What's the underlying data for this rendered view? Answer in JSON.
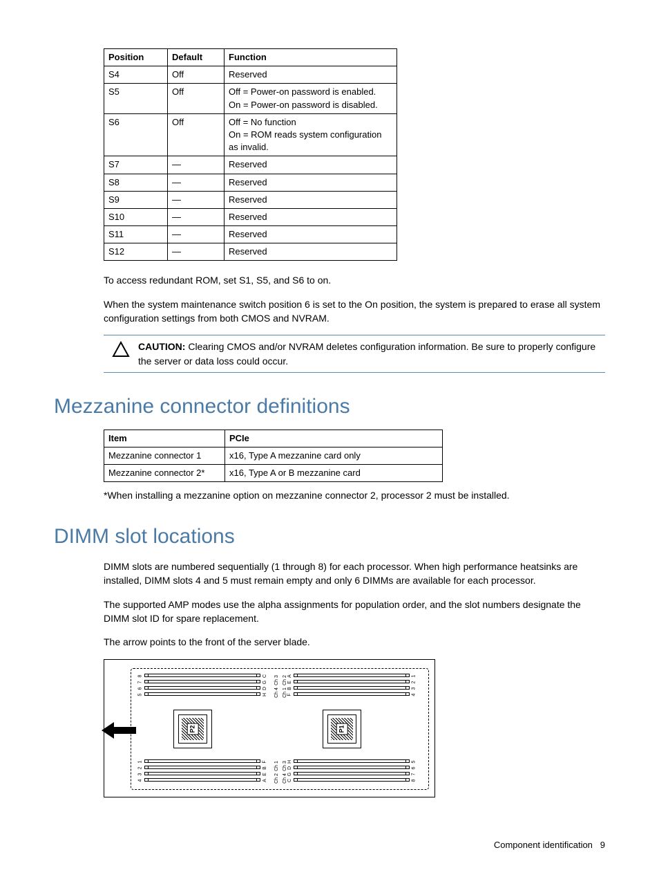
{
  "table1": {
    "headers": [
      "Position",
      "Default",
      "Function"
    ],
    "rows": [
      {
        "pos": "S4",
        "def": "Off",
        "fun": "Reserved"
      },
      {
        "pos": "S5",
        "def": "Off",
        "fun": "Off = Power-on password is enabled.\nOn = Power-on password is disabled."
      },
      {
        "pos": "S6",
        "def": "Off",
        "fun": "Off = No function\nOn = ROM reads system configuration as invalid."
      },
      {
        "pos": "S7",
        "def": "—",
        "fun": "Reserved"
      },
      {
        "pos": "S8",
        "def": "—",
        "fun": "Reserved"
      },
      {
        "pos": "S9",
        "def": "—",
        "fun": "Reserved"
      },
      {
        "pos": "S10",
        "def": "—",
        "fun": "Reserved"
      },
      {
        "pos": "S11",
        "def": "—",
        "fun": "Reserved"
      },
      {
        "pos": "S12",
        "def": "—",
        "fun": "Reserved"
      }
    ]
  },
  "para1": "To access redundant ROM, set S1, S5, and S6 to on.",
  "para2": "When the system maintenance switch position 6 is set to the On position, the system is prepared to erase all system configuration settings from both CMOS and NVRAM.",
  "caution_label": "CAUTION:",
  "caution_text": "  Clearing CMOS and/or NVRAM deletes configuration information. Be sure to properly configure the server or data loss could occur.",
  "heading1": "Mezzanine connector definitions",
  "table2": {
    "headers": [
      "Item",
      "PCIe"
    ],
    "rows": [
      {
        "item": "Mezzanine connector 1",
        "pcie": "x16, Type A mezzanine card only"
      },
      {
        "item": "Mezzanine connector 2*",
        "pcie": "x16, Type A or B mezzanine card"
      }
    ]
  },
  "footnote1": "*When installing a mezzanine option on mezzanine connector 2, processor 2 must be installed.",
  "heading2": "DIMM slot locations",
  "para3": "DIMM slots are numbered sequentially (1 through 8) for each processor. When high performance heatsinks are installed, DIMM slots 4 and 5 must remain empty and only 6 DIMMs are available for each processor.",
  "para4": "The supported AMP modes use the alpha assignments for population order, and the slot numbers designate the DIMM slot ID for spare replacement.",
  "para5": "The arrow points to the front of the server blade.",
  "diagram": {
    "p1": "P1",
    "p2": "P2",
    "ch1": "Ch 1",
    "ch2": "Ch 2",
    "ch3": "Ch 3",
    "ch4": "Ch 4",
    "nums_top_left": [
      "8",
      "7",
      "6",
      "5"
    ],
    "nums_top_right": [
      "1",
      "2",
      "3",
      "4"
    ],
    "nums_bot_left": [
      "1",
      "2",
      "3",
      "4"
    ],
    "nums_bot_right": [
      "5",
      "6",
      "7",
      "8"
    ],
    "letters_tl": [
      "C",
      "G",
      "D",
      "H"
    ],
    "letters_tr": [
      "A",
      "E",
      "B",
      "F"
    ],
    "letters_bl": [
      "F",
      "B",
      "E",
      "A"
    ],
    "letters_br": [
      "H",
      "D",
      "G",
      "C"
    ]
  },
  "footer_text": "Component identification",
  "footer_page": "9"
}
